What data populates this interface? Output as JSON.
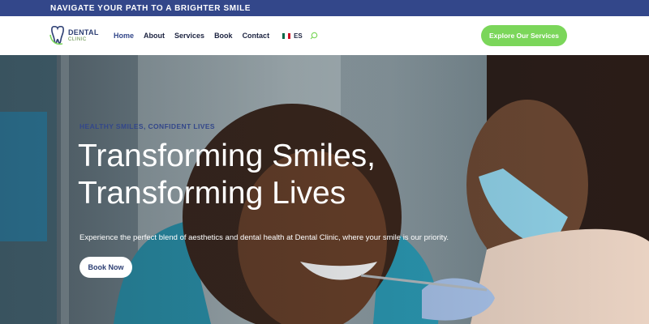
{
  "topbar": {
    "text": "NAVIGATE YOUR PATH TO A BRIGHTER SMILE"
  },
  "logo": {
    "line1": "DENTAL",
    "line2": "CLINIC"
  },
  "nav": {
    "items": [
      {
        "label": "Home"
      },
      {
        "label": "About"
      },
      {
        "label": "Services"
      },
      {
        "label": "Book"
      },
      {
        "label": "Contact"
      }
    ],
    "language": "ES"
  },
  "cta": {
    "label": "Explore Our Services"
  },
  "hero": {
    "eyebrow": "HEALTHY SMILES, CONFIDENT LIVES",
    "headline": "Transforming Smiles, Transforming Lives",
    "subtext": "Experience the perfect blend of aesthetics and dental health at Dental Clinic, where your smile is our priority.",
    "button": "Book Now"
  },
  "colors": {
    "brand_blue": "#33478a",
    "accent_green": "#7bd65a"
  },
  "icons": {
    "logo": "tooth-icon",
    "language_flag": "mexico-flag-icon",
    "search": "search-icon"
  }
}
